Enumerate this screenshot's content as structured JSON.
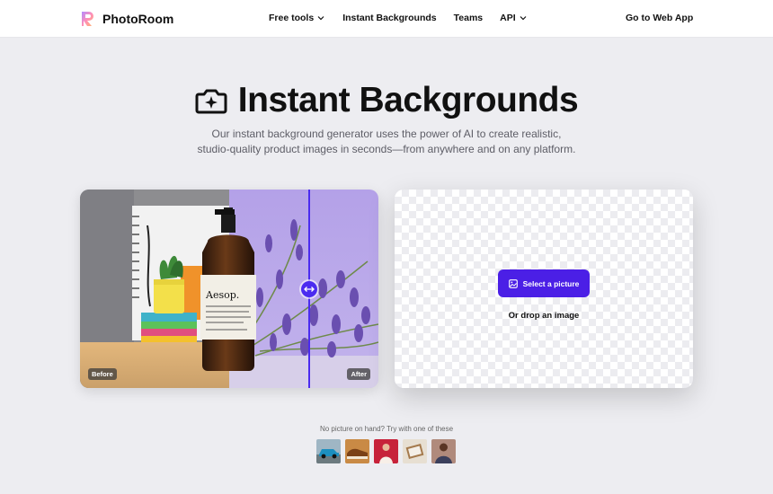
{
  "brand": {
    "name": "PhotoRoom"
  },
  "nav": {
    "items": [
      {
        "label": "Free tools",
        "dropdown": true
      },
      {
        "label": "Instant Backgrounds",
        "dropdown": false
      },
      {
        "label": "Teams",
        "dropdown": false
      },
      {
        "label": "API",
        "dropdown": true
      }
    ],
    "cta": "Go to Web App"
  },
  "hero": {
    "title": "Instant Backgrounds",
    "subtitle_line1": "Our instant background generator uses the power of AI to create realistic,",
    "subtitle_line2": "studio-quality product images in seconds—from anywhere and on any platform."
  },
  "compare": {
    "before_label": "Before",
    "after_label": "After",
    "bottle_label": "Aesop."
  },
  "upload": {
    "button_label": "Select a picture",
    "drop_label": "Or drop an image"
  },
  "samples": {
    "label": "No picture on hand? Try with one of these",
    "items": [
      "car-sample",
      "shoe-sample",
      "red-outfit-sample",
      "notebook-sample",
      "person-sample"
    ]
  },
  "colors": {
    "accent": "#4b1fe6",
    "background": "#ededf1",
    "header": "#ffffff"
  }
}
